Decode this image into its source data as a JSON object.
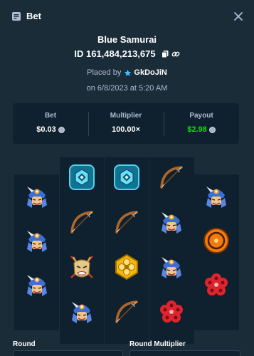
{
  "header": {
    "title": "Bet",
    "bet_icon": "receipt-icon",
    "close_icon": "close-icon"
  },
  "bet": {
    "game_name": "Blue Samurai",
    "id_label": "ID 161,484,213,675",
    "placed_by_prefix": "Placed by",
    "username": "GkDoJiN",
    "date_text": "on 6/8/2023 at 5:20 AM"
  },
  "stats": {
    "bet_label": "Bet",
    "bet_value": "$0.03",
    "multiplier_label": "Multiplier",
    "multiplier_value": "100.00×",
    "payout_label": "Payout",
    "payout_value": "$2.98",
    "payout_color": "#00e701"
  },
  "reels": [
    [
      "samurai",
      "samurai",
      "samurai"
    ],
    [
      "shuriken-badge",
      "bow",
      "mask",
      "samurai"
    ],
    [
      "shuriken-badge",
      "bow",
      "gold-flower",
      "bow"
    ],
    [
      "bow",
      "samurai",
      "samurai",
      "red-flower"
    ],
    [
      "samurai",
      "orange-mon",
      "red-flower"
    ]
  ],
  "footer": {
    "round_label": "Round",
    "round_multiplier_label": "Round Multiplier"
  },
  "colors": {
    "background": "#1a2c38",
    "panel": "#0f212e",
    "muted_text": "#b1bad3"
  }
}
